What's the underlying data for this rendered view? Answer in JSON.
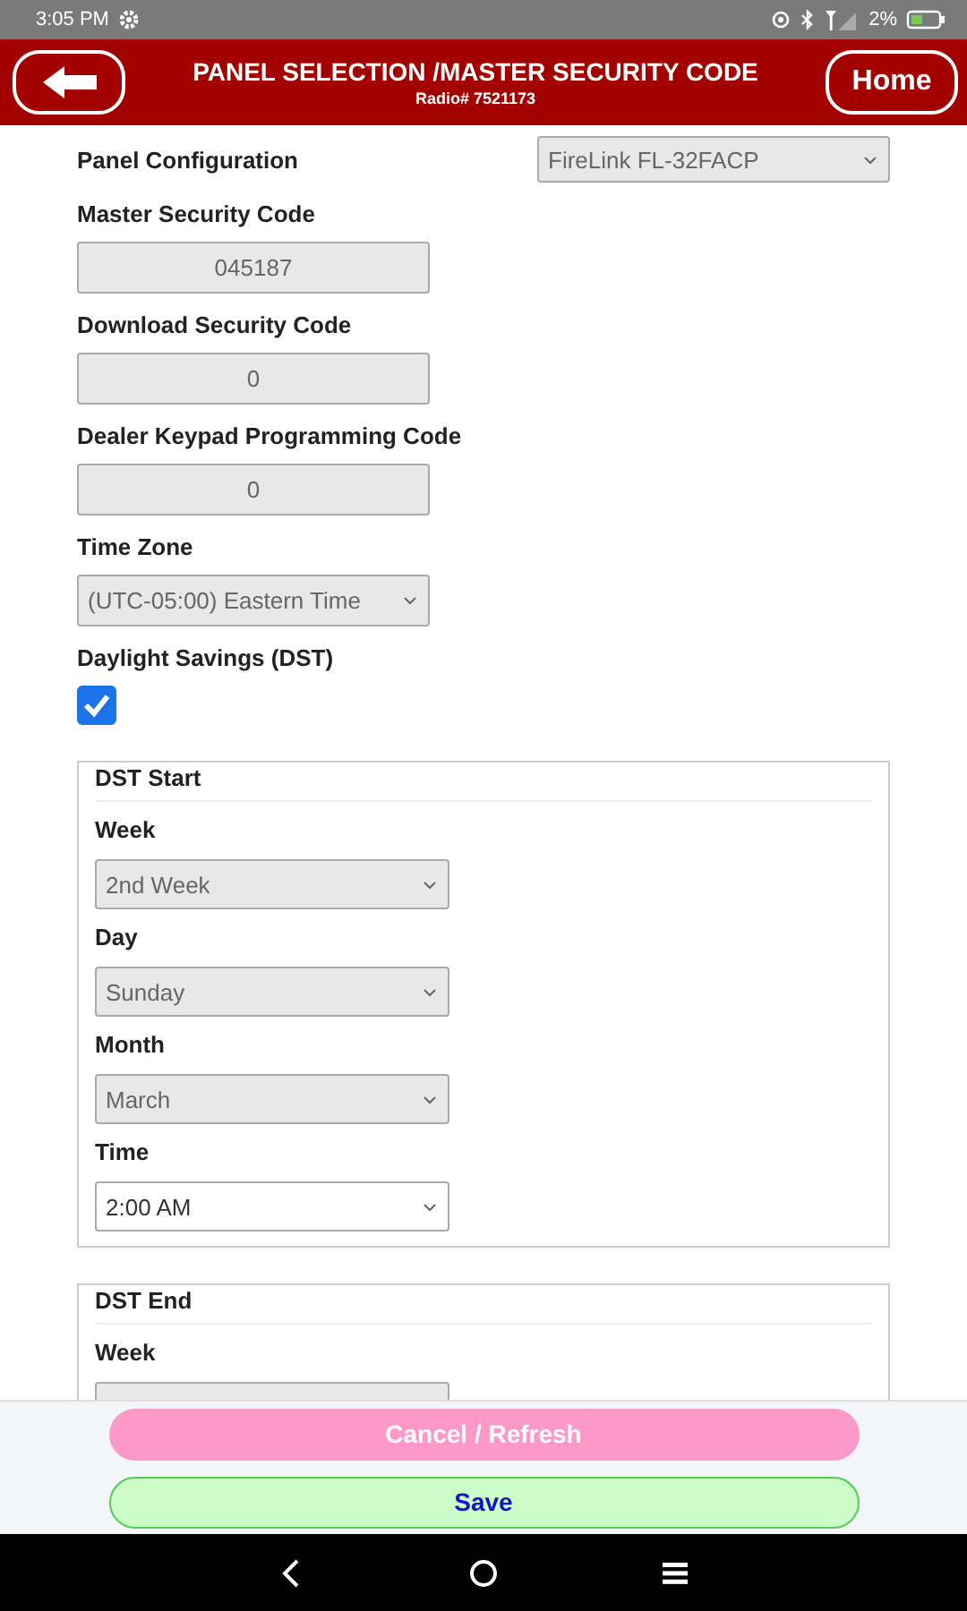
{
  "status_bar": {
    "time": "3:05 PM",
    "battery": "2%"
  },
  "header": {
    "title": "PANEL SELECTION /MASTER SECURITY CODE",
    "subtitle": "Radio# 7521173",
    "home_button": "Home"
  },
  "fields": [
    {
      "kind": "select_inline",
      "label": "Panel Configuration",
      "value": "FireLink FL-32FACP",
      "disabled": true
    },
    {
      "kind": "input",
      "label": "Master Security Code",
      "value": "045187",
      "disabled": true
    },
    {
      "kind": "input",
      "label": "Download Security Code",
      "value": "0",
      "disabled": true
    },
    {
      "kind": "input",
      "label": "Dealer Keypad Programming Code",
      "value": "0",
      "disabled": true
    },
    {
      "kind": "select",
      "label": "Time Zone",
      "value": "(UTC-05:00) Eastern Time",
      "disabled": true
    },
    {
      "kind": "checkbox",
      "label": "Daylight Savings (DST)",
      "checked": true
    }
  ],
  "groups": [
    {
      "legend": "DST Start",
      "fields": [
        {
          "label": "Week",
          "value": "2nd Week",
          "disabled": true
        },
        {
          "label": "Day",
          "value": "Sunday",
          "disabled": true
        },
        {
          "label": "Month",
          "value": "March",
          "disabled": true
        },
        {
          "label": "Time",
          "value": "2:00 AM",
          "disabled": false
        }
      ]
    },
    {
      "legend": "DST End",
      "fields": [
        {
          "label": "Week",
          "disabled": true
        }
      ]
    }
  ],
  "footer_buttons": [
    {
      "kind": "cancel",
      "label": "Cancel / Refresh"
    },
    {
      "kind": "save",
      "label": "Save"
    }
  ]
}
